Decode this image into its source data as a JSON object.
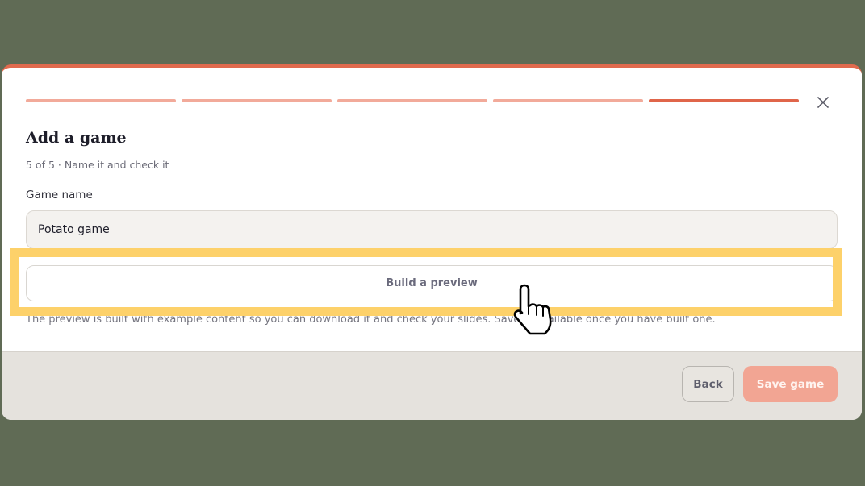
{
  "progress": {
    "total_steps": 5,
    "current_step": 5,
    "inactive_color": "#f2aa9a",
    "active_color": "#e0654a"
  },
  "header": {
    "title": "Add a game",
    "subtitle": "5 of 5 · Name it and check it",
    "close_icon": "close-icon"
  },
  "form": {
    "name_label": "Game name",
    "name_value": "Potato game"
  },
  "preview": {
    "button_label": "Build a preview",
    "help_text": "The preview is built with example content so you can download it and check your slides. Save is available once you have built one."
  },
  "footer": {
    "back_label": "Back",
    "save_label": "Save game"
  },
  "colors": {
    "accent": "#e0654a",
    "highlight": "#fdd16a",
    "backdrop": "#606b55"
  }
}
